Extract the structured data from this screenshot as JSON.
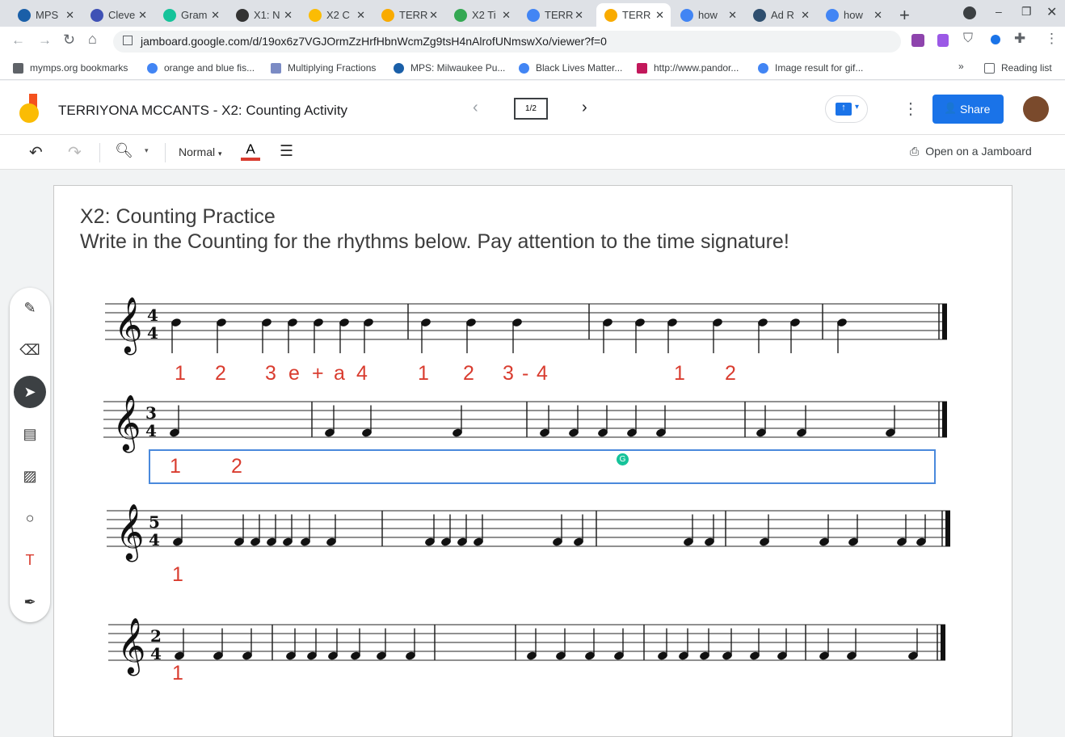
{
  "browser": {
    "tabs": [
      {
        "label": "MPS",
        "color": "#1a5fa8"
      },
      {
        "label": "Cleve",
        "color": "#3f51b5"
      },
      {
        "label": "Gram",
        "color": "#15c39a"
      },
      {
        "label": "X1: N",
        "color": "#333333"
      },
      {
        "label": "X2 C",
        "color": "#fbbc04"
      },
      {
        "label": "TERR",
        "color": "#f9ab00"
      },
      {
        "label": "X2 Ti",
        "color": "#34a853"
      },
      {
        "label": "TERR",
        "color": "#4285f4"
      },
      {
        "label": "TERR",
        "color": "#f9ab00"
      },
      {
        "label": "how",
        "color": "#4285f4"
      },
      {
        "label": "Ad R",
        "color": "#2f4f6f"
      },
      {
        "label": "how",
        "color": "#4285f4"
      }
    ],
    "url": "jamboard.google.com/d/19ox6z7VGJOrmZzHrfHbnWcmZg9tsH4nAlrofUNmswXo/viewer?f=0",
    "bookmarks": [
      "mymps.org bookmarks",
      "orange and blue fis...",
      "Multiplying Fractions",
      "MPS: Milwaukee Pu...",
      "Black Lives Matter...",
      "http://www.pandor...",
      "Image result for gif..."
    ],
    "reading_list": "Reading list"
  },
  "app": {
    "title": "TERRIYONA MCCANTS - X2: Counting Activity",
    "frame_indicator": "1/2",
    "share": "Share",
    "font_style": "Normal",
    "open_on_jamboard": "Open on a Jamboard",
    "accent": "#1a73e8"
  },
  "frame": {
    "heading": "X2: Counting Practice",
    "instructions": "Write in the Counting for the rhythms below. Pay attention to the time signature!",
    "staves": [
      {
        "time_top": "4",
        "time_bottom": "4",
        "counts": [
          "1",
          "2",
          "3",
          "e",
          "+",
          "a",
          "4",
          "1",
          "2",
          "3",
          "-",
          "4",
          "1",
          "2"
        ]
      },
      {
        "time_top": "3",
        "time_bottom": "4",
        "counts": [
          "1",
          "2"
        ]
      },
      {
        "time_top": "5",
        "time_bottom": "4",
        "counts": [
          "1"
        ]
      },
      {
        "time_top": "2",
        "time_bottom": "4",
        "counts": [
          "1"
        ]
      }
    ],
    "count_color": "#d93c2f"
  }
}
